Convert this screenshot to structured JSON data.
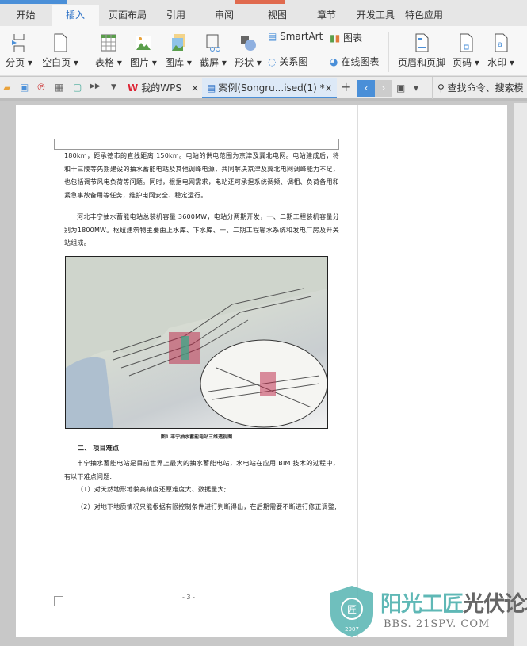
{
  "tabs": [
    "开始",
    "插入",
    "页面布局",
    "引用",
    "审阅",
    "视图",
    "章节",
    "开发工具",
    "特色应用"
  ],
  "active_tab": "插入",
  "ribbon": {
    "page_break": "分页",
    "blank_page": "空白页",
    "table": "表格",
    "picture": "图片",
    "gallery": "图库",
    "screenshot": "截屏",
    "shapes": "形状",
    "smartart": "SmartArt",
    "chart": "图表",
    "relation": "关系图",
    "online_chart": "在线图表",
    "header_footer": "页眉和页脚",
    "page_number": "页码",
    "watermark": "水印"
  },
  "quickbar": {
    "tab_wps": "我的WPS",
    "tab_doc": "案例(Songru...ised(1) *",
    "close": "×",
    "add": "+",
    "search": "查找命令、搜索模"
  },
  "document": {
    "paragraphs": [
      "180km，距承德市的直线距离 150km。电站的供电范围为京津及冀北电网。电站建成后，将和十三陵等先期建设的抽水蓄能电站及其他调峰电源，共同解决京津及冀北电网调峰能力不足，也包括调节风电负荷等问题。同时，根据电网需求，电站还可承担系统调频、调相、负荷备用和紧急事故备用等任务，维护电网安全、稳定运行。",
      "河北丰宁抽水蓄能电站总装机容量 3600MW，电站分两期开发，一、二期工程装机容量分别为1800MW。枢纽建筑物主要由上水库、下水库、一、二期工程输水系统和发电厂房及开关站组成。"
    ],
    "figure_caption": "图1 丰宁抽水蓄能电站三维透视图",
    "heading": "二、 项目难点",
    "paragraphs2": [
      "丰宁抽水蓄能电站是目前世界上最大的抽水蓄能电站，水电站在应用 BIM 技术的过程中，有以下难点问题:",
      "（1）对天然地形地貌高精度还原难度大、数据量大;",
      "（2）对地下地质情况只能根据有限控制条件进行判断得出，在后期需要不断进行修正调整;"
    ],
    "page_number": "- 3 -"
  },
  "watermark": {
    "cn1": "阳光工匠",
    "cn2": "光伏论坛",
    "url": "BBS. 21SPV. COM",
    "year": "2007"
  },
  "colors": {
    "accent": "#2a70c6",
    "logo_teal": "#5fb8b6"
  }
}
